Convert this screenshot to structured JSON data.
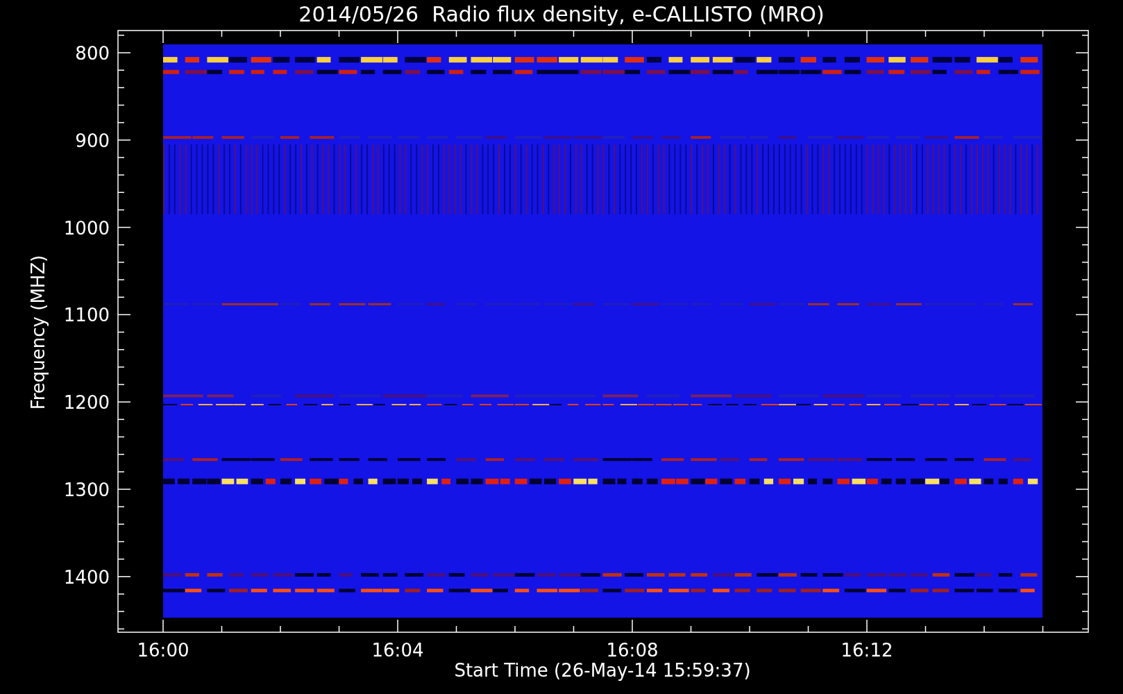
{
  "title": "2014/05/26  Radio flux density, e-CALLISTO (MRO)",
  "y_axis": {
    "label": "Frequency (MHZ)",
    "ticks": [
      "800",
      "900",
      "1000",
      "1100",
      "1200",
      "1300",
      "1400"
    ]
  },
  "x_axis": {
    "label": "Start Time (26-May-14 15:59:37)",
    "ticks": [
      "16:00",
      "16:04",
      "16:08",
      "16:12"
    ]
  }
}
